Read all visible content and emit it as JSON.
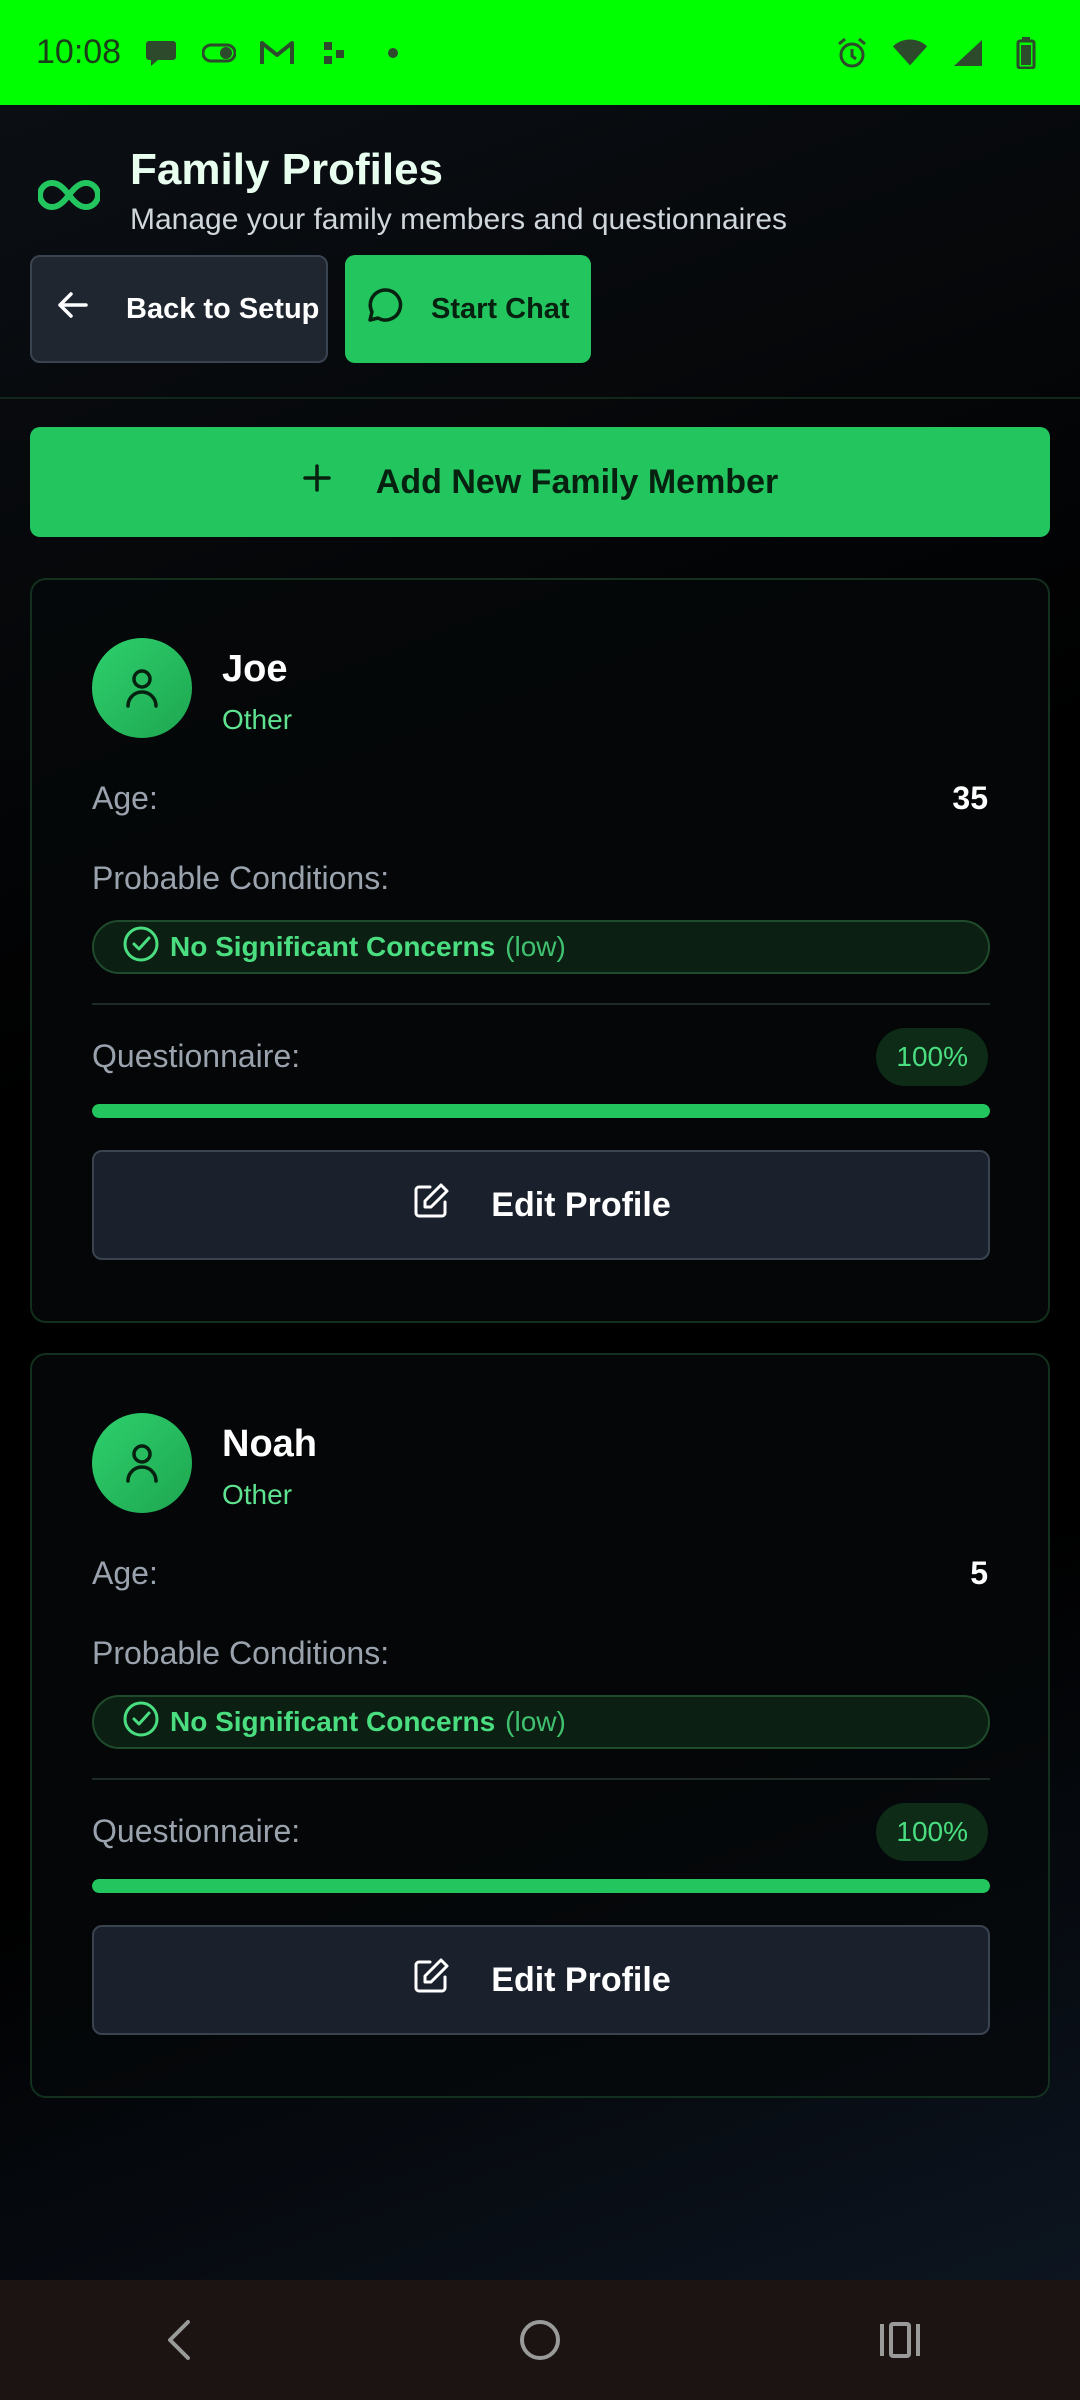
{
  "status_bar": {
    "time": "10:08",
    "left_icons": [
      "chat-bubble-icon",
      "toggle-icon",
      "gmail-icon",
      "dots-icon",
      "dot-icon"
    ],
    "right_icons": [
      "alarm-icon",
      "wifi-icon",
      "signal-icon",
      "battery-icon"
    ],
    "color": "#00ff00"
  },
  "header": {
    "logo_icon": "infinity-icon",
    "title": "Family Profiles",
    "subtitle": "Manage your family members and questionnaires",
    "back_label": "Back to Setup",
    "chat_label": "Start Chat"
  },
  "add_member_label": "Add New Family Member",
  "members": [
    {
      "name": "Joe",
      "relation": "Other",
      "age_label": "Age:",
      "age": "35",
      "conditions_label": "Probable Conditions:",
      "condition": "No Significant Concerns",
      "condition_level": "(low)",
      "questionnaire_label": "Questionnaire:",
      "questionnaire_percent_label": "100%",
      "questionnaire_progress": 1.0,
      "edit_label": "Edit Profile"
    },
    {
      "name": "Noah",
      "relation": "Other",
      "age_label": "Age:",
      "age": "5",
      "conditions_label": "Probable Conditions:",
      "condition": "No Significant Concerns",
      "condition_level": "(low)",
      "questionnaire_label": "Questionnaire:",
      "questionnaire_percent_label": "100%",
      "questionnaire_progress": 1.0,
      "edit_label": "Edit Profile"
    }
  ],
  "colors": {
    "accent": "#22c55e",
    "accent_text": "#4ade80"
  }
}
